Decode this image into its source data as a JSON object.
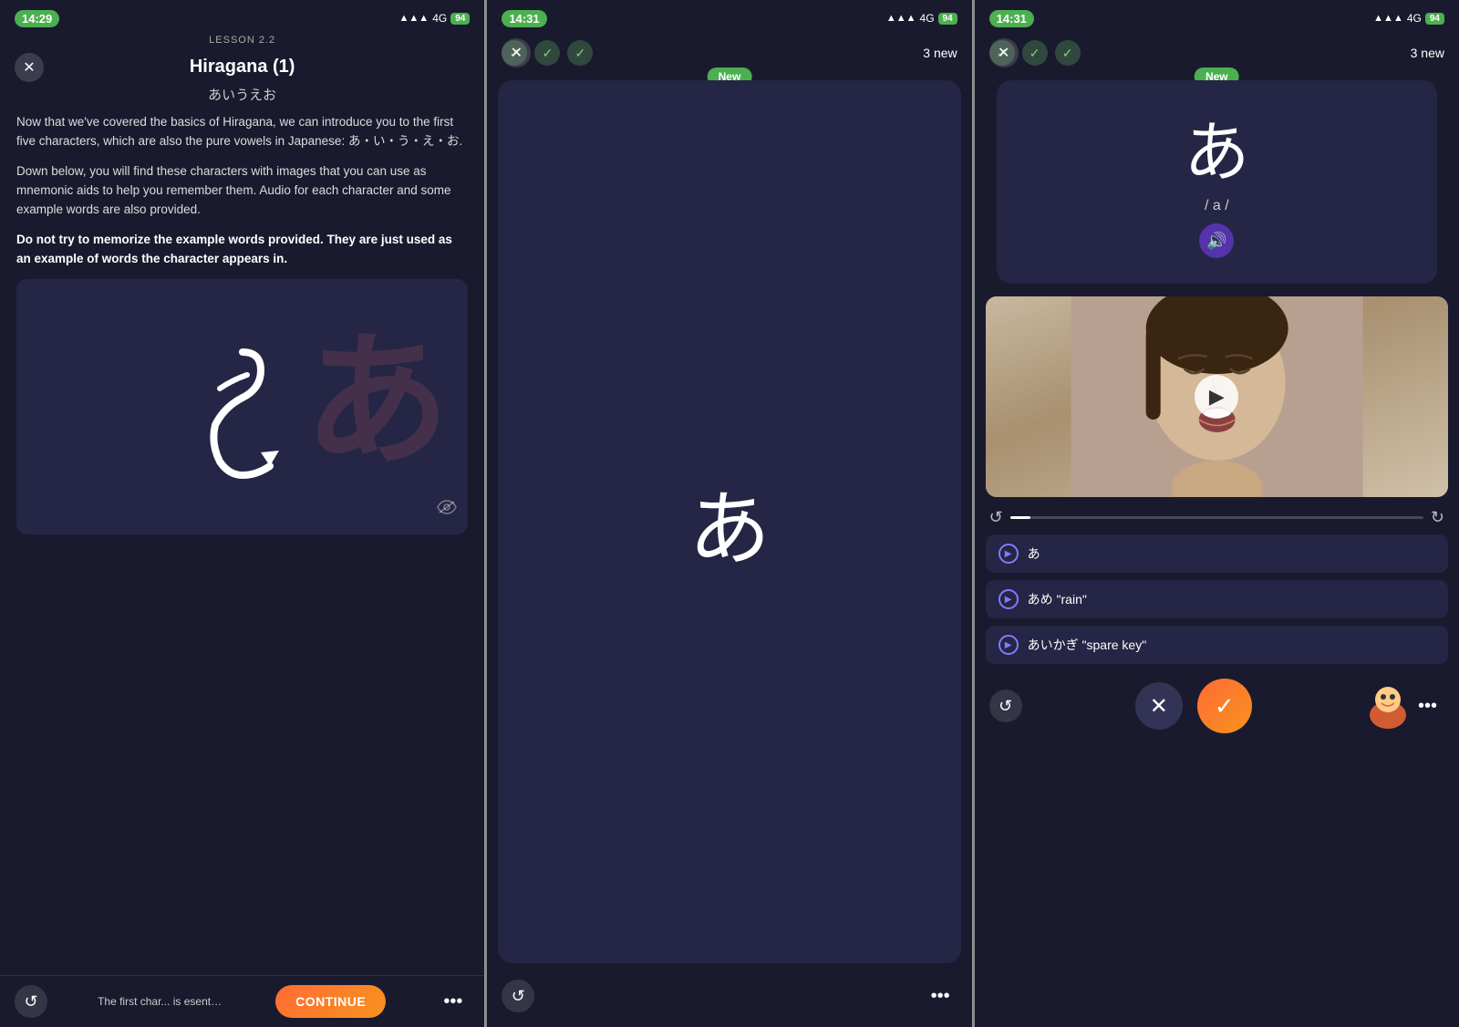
{
  "screens": [
    {
      "id": "screen1",
      "statusBar": {
        "time": "14:29",
        "signal": "▲▲▲",
        "network": "4G",
        "battery": "94"
      },
      "lessonLabel": "LESSON 2.2",
      "title": "Hiragana (1)",
      "subtitle": "あいうえお",
      "body": [
        "Now that we've covered the basics of Hiragana, we can introduce you to the first five characters, which are also the pure vowels in Japanese: あ・い・う・え・お.",
        "Down below, you will find these characters with images that you can use as mnemonic aids to help you remember them. Audio for each character and some example words are also provided.",
        "Do not try to memorize the example words provided. They are just used as an example of words the character appears in."
      ],
      "bodyBold": "Do not try to memorize the example words provided. They are just used as an example of words the character appears in.",
      "mnemonicChar": "あ",
      "bottomPreview": "The first char    h is esented a    ciation is similar to the a in father.",
      "continueLabel": "CONTINUE"
    },
    {
      "id": "screen2",
      "statusBar": {
        "time": "14:31",
        "signal": "▲▲▲",
        "network": "4G",
        "battery": "94"
      },
      "checks": [
        true,
        true,
        true
      ],
      "newCount": "3 new",
      "newBadge": "New",
      "cardChar": "あ"
    },
    {
      "id": "screen3",
      "statusBar": {
        "time": "14:31",
        "signal": "▲▲▲",
        "network": "4G",
        "battery": "94"
      },
      "checks": [
        true,
        true,
        true
      ],
      "newCount": "3 new",
      "newBadge": "New",
      "cardChar": "あ",
      "cardRomaji": "/ a /",
      "words": [
        {
          "text": "あ"
        },
        {
          "text": "あめ \"rain\""
        },
        {
          "text": "あいかぎ \"spare key\""
        }
      ]
    }
  ],
  "icons": {
    "close": "✕",
    "back": "↺",
    "check": "✓",
    "dots": "•••",
    "eye": "👁",
    "play": "▶",
    "audio": "🔊",
    "replay": "↺",
    "forward": "↻",
    "wrong": "✕",
    "correct": "✓"
  }
}
